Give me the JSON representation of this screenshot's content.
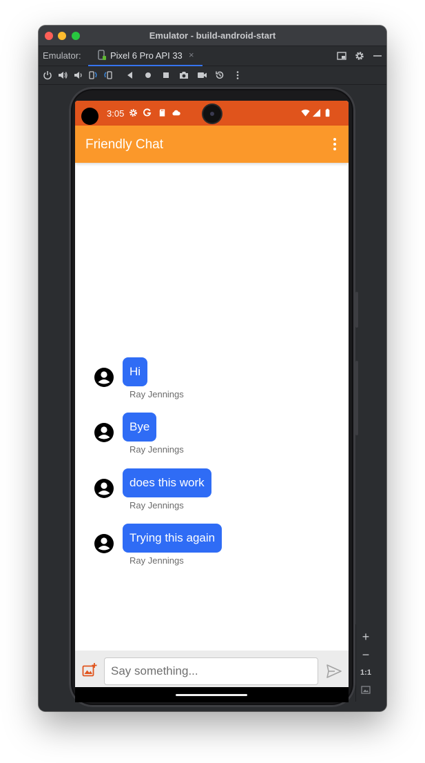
{
  "window": {
    "title": "Emulator - build-android-start"
  },
  "tabbar": {
    "label": "Emulator:",
    "tab": {
      "label": "Pixel 6 Pro API 33",
      "close": "×"
    },
    "icons": [
      "window-layout-icon",
      "gear-icon",
      "minimize-icon"
    ]
  },
  "toolbar": {
    "icons": [
      "power-icon",
      "volume-up-icon",
      "volume-down-icon",
      "rotate-left-icon",
      "rotate-right-icon",
      "back-icon",
      "home-icon",
      "overview-icon",
      "screenshot-icon",
      "screen-record-icon",
      "snapshot-icon",
      "more-icon"
    ]
  },
  "statusbar": {
    "time": "3:05",
    "left_icons": [
      "settings-icon",
      "google-icon",
      "sd-card-icon",
      "cloud-icon"
    ],
    "right_icons": [
      "wifi-icon",
      "cell-signal-icon",
      "battery-icon"
    ],
    "color": "#e0541c"
  },
  "app": {
    "title": "Friendly Chat",
    "appbar_color": "#fb982a",
    "bubble_color": "#2f6cf5"
  },
  "messages": [
    {
      "text": "Hi",
      "sender": "Ray Jennings"
    },
    {
      "text": "Bye",
      "sender": "Ray Jennings"
    },
    {
      "text": "does this work",
      "sender": "Ray Jennings"
    },
    {
      "text": "Trying this again",
      "sender": "Ray Jennings"
    }
  ],
  "input": {
    "placeholder": "Say something..."
  },
  "zoom": {
    "plus": "+",
    "minus": "−",
    "one_to_one": "1:1"
  }
}
